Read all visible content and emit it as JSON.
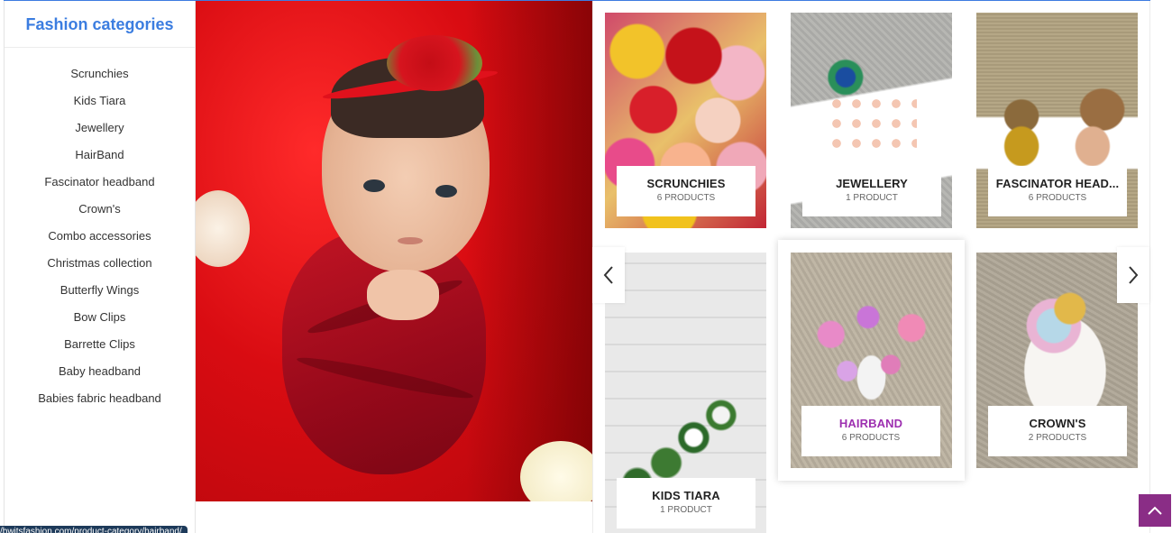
{
  "sidebar": {
    "title": "Fashion categories",
    "items": [
      {
        "label": "Scrunchies"
      },
      {
        "label": "Kids Tiara"
      },
      {
        "label": "Jewellery"
      },
      {
        "label": "HairBand"
      },
      {
        "label": "Fascinator headband"
      },
      {
        "label": "Crown's"
      },
      {
        "label": "Combo accessories"
      },
      {
        "label": "Christmas collection"
      },
      {
        "label": "Butterfly Wings"
      },
      {
        "label": "Bow Clips"
      },
      {
        "label": "Barrette Clips"
      },
      {
        "label": "Baby headband"
      },
      {
        "label": "Babies fabric headband"
      }
    ]
  },
  "categories": [
    {
      "name": "Scrunchies",
      "count": "6 Products"
    },
    {
      "name": "Jewellery",
      "count": "1 Product"
    },
    {
      "name": "Fascinator head...",
      "count": "6 Products"
    },
    {
      "name": "Kids Tiara",
      "count": "1 Product"
    },
    {
      "name": "HairBand",
      "count": "6 Products"
    },
    {
      "name": "Crown's",
      "count": "2 Products"
    }
  ],
  "icons": {
    "prev": "chevron-left-icon",
    "next": "chevron-right-icon",
    "back_to_top": "chevron-up-icon"
  },
  "colors": {
    "title_blue": "#3b7de0",
    "active_purple": "#9d2fb0",
    "back_to_top_bg": "#8a2d86"
  },
  "status_bar": {
    "url": "/bwitsfashion.com/product-category/hairband/"
  }
}
